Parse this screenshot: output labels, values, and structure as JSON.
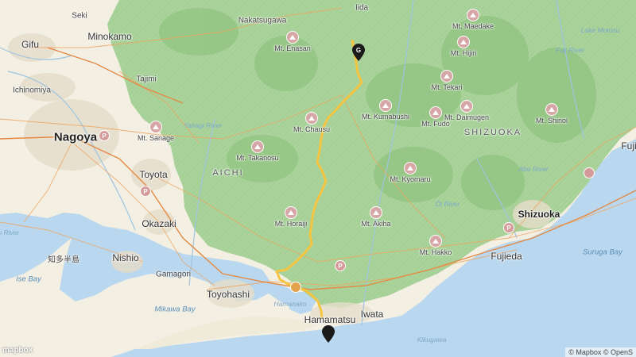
{
  "map": {
    "route_color": "#f5c542",
    "markers": {
      "goal_label": "G",
      "start_label": ""
    },
    "attribution": "© Mapbox © OpenS",
    "logo_text": "mapbox"
  },
  "labels": {
    "nagoya": "Nagoya",
    "gifu": "Gifu",
    "minokamo": "Minokamo",
    "seki": "Seki",
    "ichinomiya": "Ichinomiya",
    "tajimi": "Tajimi",
    "nakatsugawa": "Nakatsugawa",
    "iida": "Iida",
    "toyota": "Toyota",
    "okazaki": "Okazaki",
    "nishio": "Nishio",
    "gamagori": "Gamagori",
    "toyohashi": "Toyohashi",
    "hamamatsu": "Hamamatsu",
    "iwata": "Iwata",
    "fujieda": "Fujieda",
    "shizuoka": "Shizuoka",
    "fuji": "Fuji",
    "aichi": "AICHI",
    "shizuoka_pref": "SHIZUOKA",
    "ise_bay": "Ise Bay",
    "mikawa_bay": "Mikawa Bay",
    "suruga_bay": "Suruga Bay",
    "lake_motosu": "Lake Motosu",
    "yahagi_river": "Yahagi River",
    "abe_river": "Abe River",
    "oi_river": "Ōi River",
    "fuji_river": "Fuji River",
    "kiso_river": "Kiso River",
    "kikugawa": "Kikugawa",
    "hamanako": "Hamanako",
    "chita_kanji": "知多半島"
  },
  "mountains": [
    {
      "name": "Mt. Enasan"
    },
    {
      "name": "Mt. Chausu"
    },
    {
      "name": "Mt. Sanage"
    },
    {
      "name": "Mt. Takanosu"
    },
    {
      "name": "Mt. Horaiji"
    },
    {
      "name": "Mt. Kumabushi"
    },
    {
      "name": "Mt. Fudo"
    },
    {
      "name": "Mt. Daimugen"
    },
    {
      "name": "Mt. Kyomaru"
    },
    {
      "name": "Mt. Akiha"
    },
    {
      "name": "Mt. Hakko"
    },
    {
      "name": "Mt. Tekari"
    },
    {
      "name": "Mt. Maedake"
    },
    {
      "name": "Mt. Hijiri"
    },
    {
      "name": "Mt. Shinoi"
    }
  ]
}
